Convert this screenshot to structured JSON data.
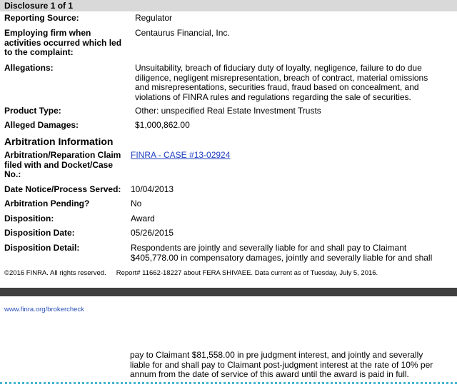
{
  "disclosure_header": "Disclosure 1 of 1",
  "fields": {
    "reporting_source": {
      "label": "Reporting Source:",
      "value": "Regulator"
    },
    "employing_firm": {
      "label": "Employing firm when activities occurred which led to the complaint:",
      "value": "Centaurus Financial, Inc."
    },
    "allegations": {
      "label": "Allegations:",
      "value": "Unsuitability, breach of fiduciary duty of loyalty, negligence, failure to do due diligence, negligent misrepresentation, breach of contract, material omissions and misrepresentations, securities fraud, fraud based on concealment, and violations of FINRA rules and regulations regarding the sale of securities."
    },
    "product_type": {
      "label": "Product Type:",
      "value": "Other: unspecified Real Estate Investment Trusts"
    },
    "alleged_damages": {
      "label": "Alleged Damages:",
      "value": "$1,000,862.00"
    }
  },
  "arbitration": {
    "section_title": "Arbitration Information",
    "claim": {
      "label": "Arbitration/Reparation Claim filed with and Docket/Case No.:",
      "value": "FINRA - CASE #13-02924"
    },
    "date_served": {
      "label": "Date Notice/Process Served:",
      "value": "10/04/2013"
    },
    "pending": {
      "label": "Arbitration Pending?",
      "value": "No"
    },
    "disposition": {
      "label": "Disposition:",
      "value": "Award"
    },
    "disposition_date": {
      "label": "Disposition Date:",
      "value": "05/26/2015"
    },
    "disposition_detail": {
      "label": "Disposition Detail:",
      "value": "Respondents are jointly and severally liable for and shall pay to Claimant $405,778.00 in compensatory damages, jointly and severally liable for and shall"
    }
  },
  "footer": {
    "copyright": "©2016 FINRA. All rights reserved.",
    "report": "Report# 11662-18227 about FERA SHIVAEE. Data current as of Tuesday, July 5, 2016."
  },
  "next_page": {
    "url": "www.finra.org/brokercheck",
    "continuation": "pay to Claimant $81,558.00 in pre judgment interest, and jointly and severally liable for and shall pay to Claimant post-judgment interest at the rate of 10% per annum from the date of service of this award until the award is paid in full."
  },
  "colors": {
    "header_bg": "#d9d9d9",
    "link": "#1f3fbf",
    "page_break": "#3f3f3f",
    "dotted_rule": "#46b5cf"
  }
}
